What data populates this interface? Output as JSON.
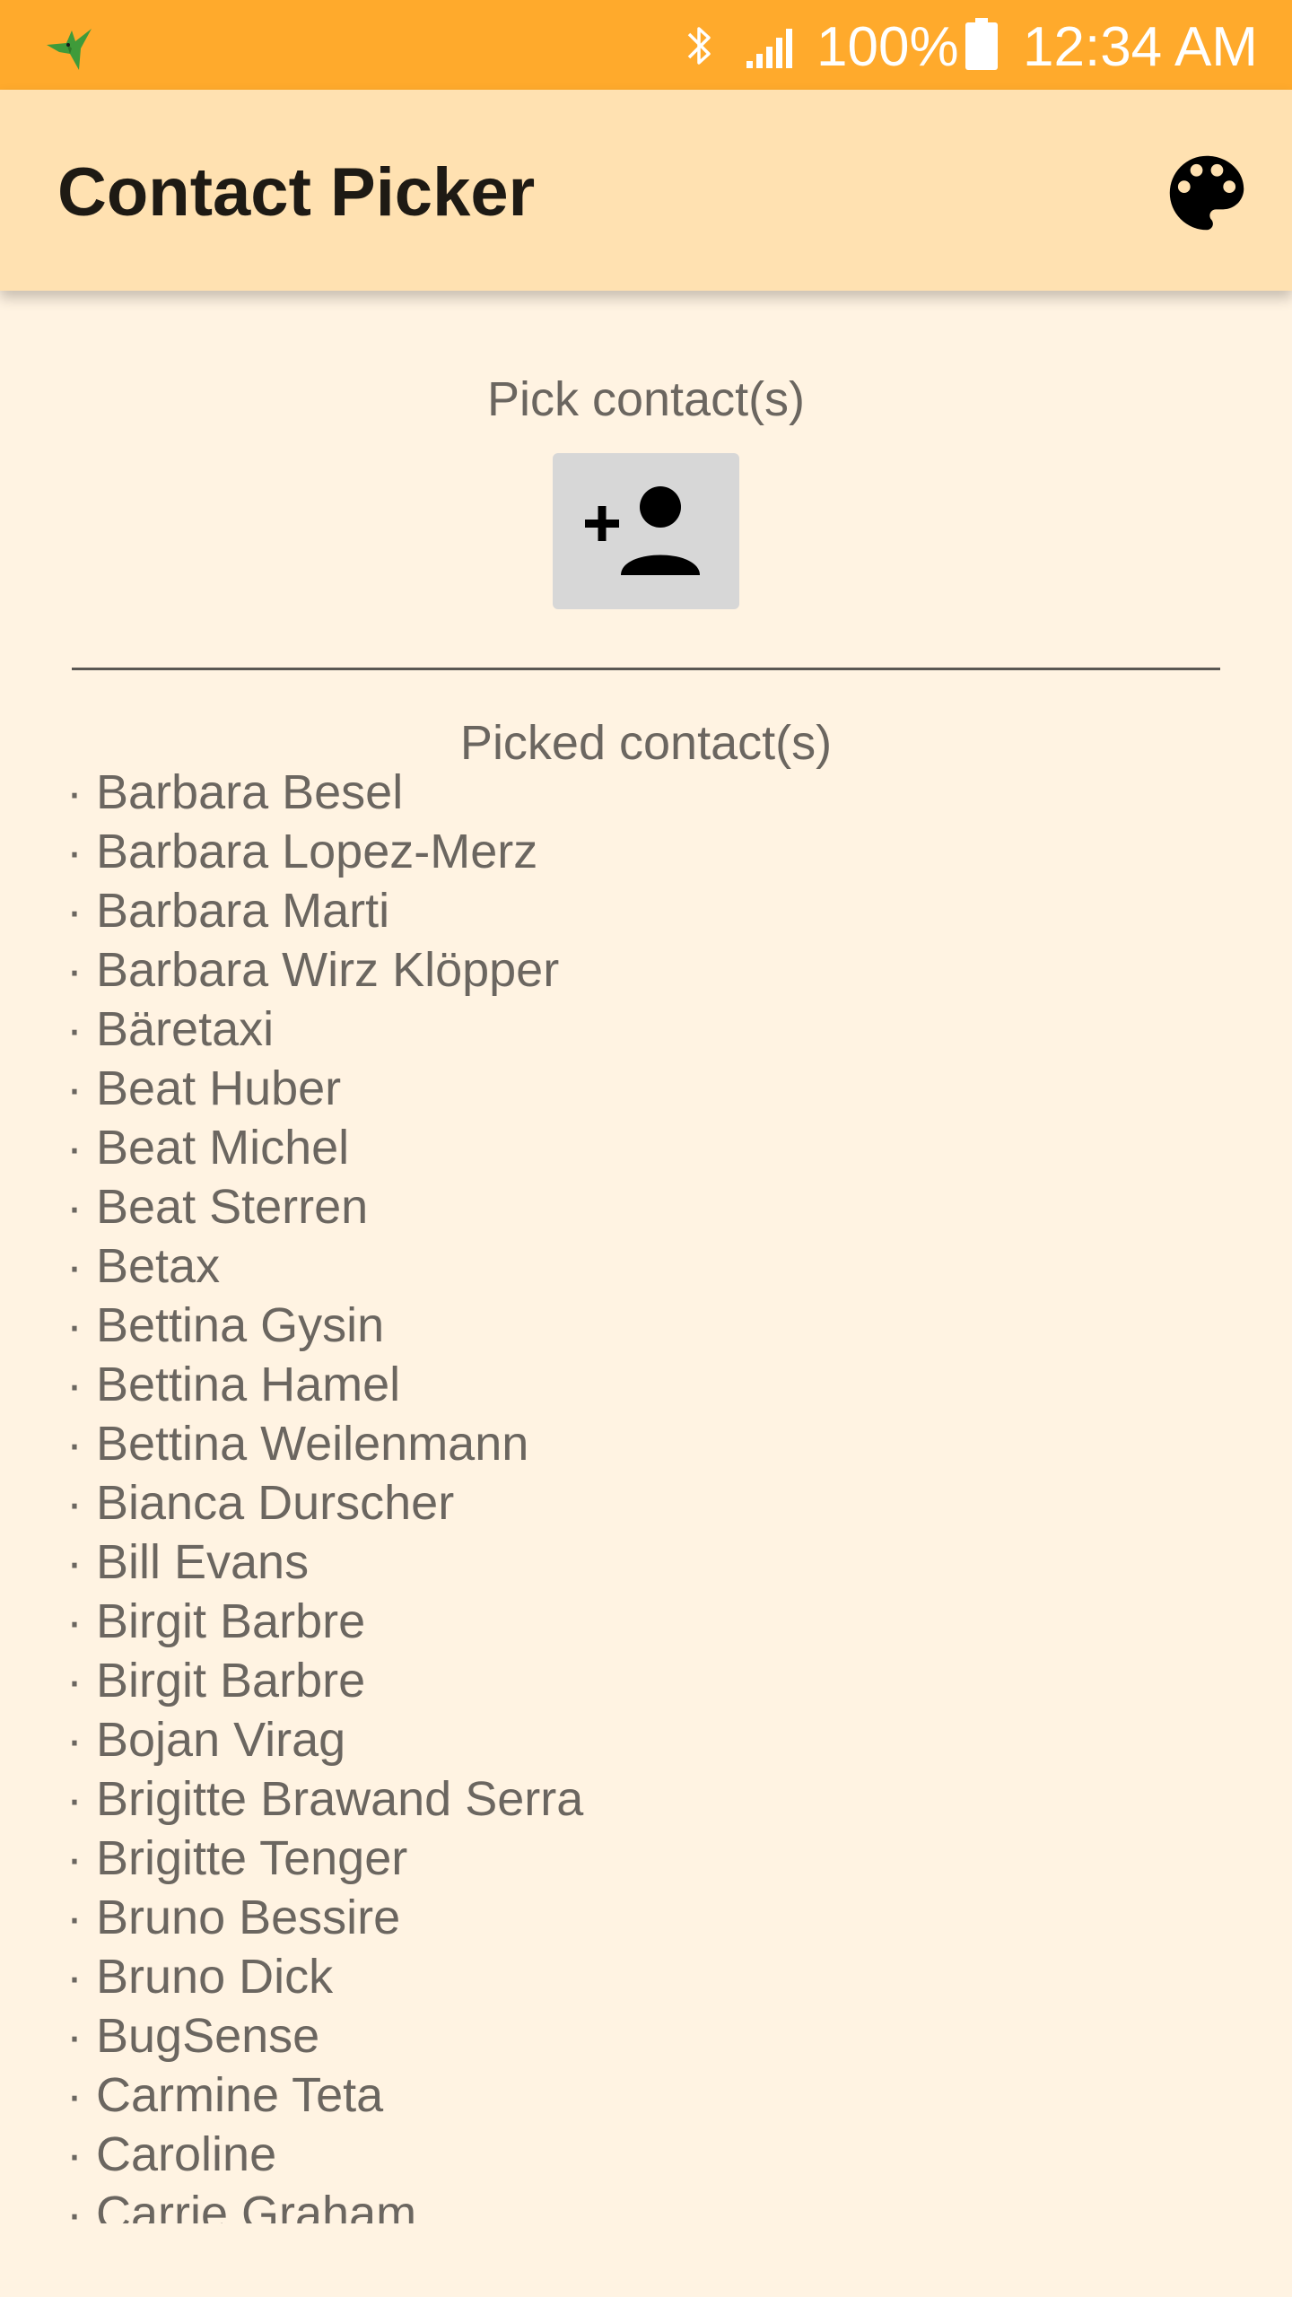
{
  "status_bar": {
    "battery_percent": "100%",
    "time": "12:34 AM",
    "icons": [
      "hummingbird-icon",
      "bluetooth-icon",
      "signal-icon",
      "battery-icon"
    ]
  },
  "app_bar": {
    "title": "Contact Picker",
    "action_icon": "palette-icon"
  },
  "main": {
    "pick_label": "Pick contact(s)",
    "pick_button_icon": "person-add-icon",
    "picked_label": "Picked contact(s)",
    "contacts": [
      "Barbara Besel",
      "Barbara Lopez-Merz",
      "Barbara Marti",
      "Barbara Wirz Klöpper",
      "Bäretaxi",
      "Beat Huber",
      "Beat Michel",
      "Beat Sterren",
      "Betax",
      "Bettina Gysin",
      "Bettina Hamel",
      "Bettina Weilenmann",
      "Bianca Durscher",
      "Bill Evans",
      "Birgit Barbre",
      "Birgit Barbre",
      "Bojan Virag",
      "Brigitte Brawand Serra",
      "Brigitte Tenger",
      "Bruno Bessire",
      "Bruno Dick",
      "BugSense",
      "Carmine Teta",
      "Caroline",
      "Carrie Graham"
    ]
  },
  "colors": {
    "status_bar": "#ffaa2c",
    "app_bar": "#ffe1b1",
    "background": "#fff3e2",
    "text": "#6b6660",
    "button": "#d7d7d7"
  }
}
